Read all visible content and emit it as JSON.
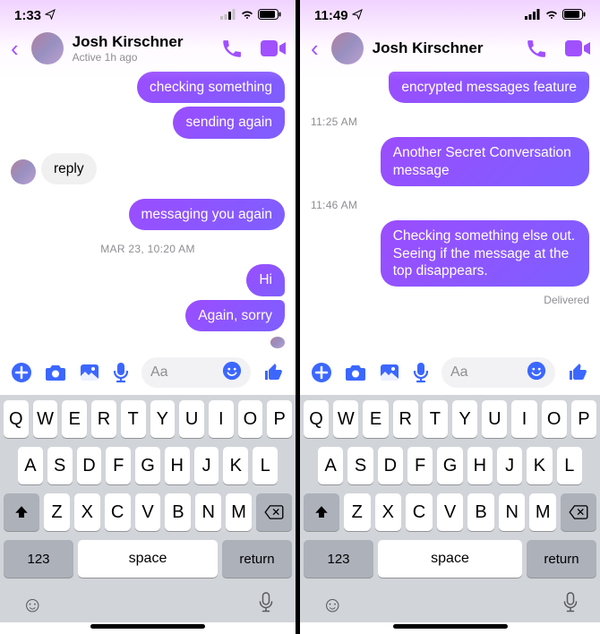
{
  "left": {
    "statusbar": {
      "time": "1:33"
    },
    "header": {
      "name": "Josh Kirschner",
      "status": "Active 1h ago"
    },
    "messages": {
      "m1": "checking something",
      "m2": "sending again",
      "m3": "reply",
      "m4": "messaging you again",
      "ts1": "MAR 23, 10:20 AM",
      "m5": "Hi",
      "m6": "Again, sorry"
    },
    "composer": {
      "placeholder": "Aa"
    },
    "keyboard": {
      "row1": [
        "Q",
        "W",
        "E",
        "R",
        "T",
        "Y",
        "U",
        "I",
        "O",
        "P"
      ],
      "row2": [
        "A",
        "S",
        "D",
        "F",
        "G",
        "H",
        "J",
        "K",
        "L"
      ],
      "row3": [
        "Z",
        "X",
        "C",
        "V",
        "B",
        "N",
        "M"
      ],
      "k123": "123",
      "space": "space",
      "return": "return"
    }
  },
  "right": {
    "statusbar": {
      "time": "11:49"
    },
    "header": {
      "name": "Josh Kirschner"
    },
    "messages": {
      "m1": "encrypted messages feature",
      "ts1": "11:25 AM",
      "m2": "Another Secret Conversation message",
      "ts2": "11:46 AM",
      "m3": "Checking something else out. Seeing if the message at the top disappears.",
      "delivered": "Delivered"
    },
    "composer": {
      "placeholder": "Aa"
    },
    "keyboard": {
      "row1": [
        "Q",
        "W",
        "E",
        "R",
        "T",
        "Y",
        "U",
        "I",
        "O",
        "P"
      ],
      "row2": [
        "A",
        "S",
        "D",
        "F",
        "G",
        "H",
        "J",
        "K",
        "L"
      ],
      "row3": [
        "Z",
        "X",
        "C",
        "V",
        "B",
        "N",
        "M"
      ],
      "k123": "123",
      "space": "space",
      "return": "return"
    }
  }
}
